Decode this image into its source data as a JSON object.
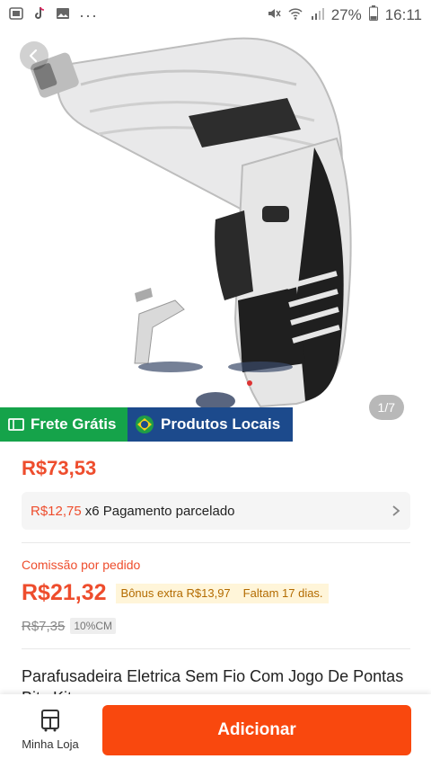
{
  "status_bar": {
    "battery": "27%",
    "time": "16:11",
    "icons": [
      "notification-icon",
      "tiktok-icon",
      "gallery-icon",
      "more-dots-icon",
      "mute-icon",
      "wifi-icon",
      "signal-icon",
      "battery-icon"
    ]
  },
  "hero": {
    "image_counter": "1/7"
  },
  "badges": {
    "shipping": "Frete Grátis",
    "local": "Produtos Locais"
  },
  "price": "R$73,53",
  "installment": {
    "amount": "R$12,75",
    "text": "x6 Pagamento parcelado"
  },
  "commission": {
    "label": "Comissão por pedido",
    "value": "R$21,32",
    "bonus": "Bônus extra R$13,97",
    "deadline": "Faltam 17 dias."
  },
  "original": {
    "price": "R$7,35",
    "tag": "10%CM"
  },
  "product_title": "Parafusadeira Eletrica Sem Fio Com Jogo De Pontas Bits Kit",
  "bottom_bar": {
    "shop_label": "Minha Loja",
    "add_label": "Adicionar"
  },
  "colors": {
    "accent": "#ee4d2d",
    "button": "#f9480e",
    "green_badge": "#15a34a",
    "blue_badge": "#1c4a8c"
  }
}
